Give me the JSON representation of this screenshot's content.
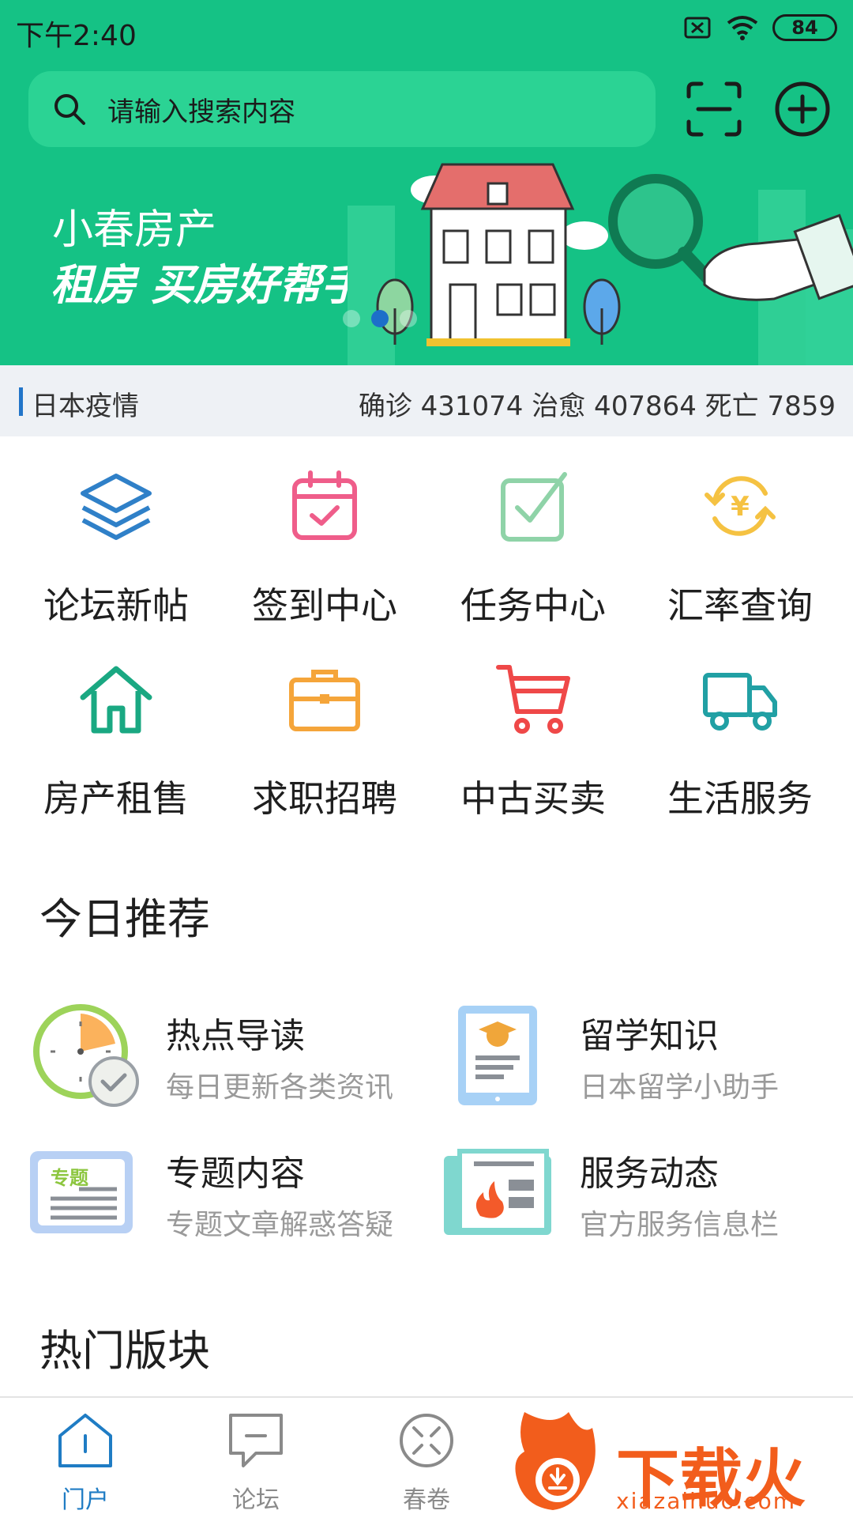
{
  "status_bar": {
    "time": "下午2:40",
    "battery": "84"
  },
  "search": {
    "placeholder": "请输入搜索内容"
  },
  "banner": {
    "title": "小春房产",
    "subtitle": "租房 买房好帮手"
  },
  "ticker": {
    "title": "日本疫情",
    "stats": "确诊 431074 治愈 407864 死亡 7859"
  },
  "grid": [
    {
      "label": "论坛新帖",
      "icon": "layers-icon",
      "color": "#2f80c8"
    },
    {
      "label": "签到中心",
      "icon": "calendar-check-icon",
      "color": "#ef5d8a"
    },
    {
      "label": "任务中心",
      "icon": "checkbox-icon",
      "color": "#8fd3a8"
    },
    {
      "label": "汇率查询",
      "icon": "currency-exchange-icon",
      "color": "#f5c242"
    },
    {
      "label": "房产租售",
      "icon": "house-icon",
      "color": "#1aa882"
    },
    {
      "label": "求职招聘",
      "icon": "briefcase-icon",
      "color": "#f5a53a"
    },
    {
      "label": "中古买卖",
      "icon": "cart-icon",
      "color": "#ef4848"
    },
    {
      "label": "生活服务",
      "icon": "truck-icon",
      "color": "#21a0a4"
    }
  ],
  "today": {
    "title": "今日推荐",
    "items": [
      {
        "title": "热点导读",
        "subtitle": "每日更新各类资讯",
        "icon": "clock-check-icon"
      },
      {
        "title": "留学知识",
        "subtitle": "日本留学小助手",
        "icon": "graduation-tablet-icon"
      },
      {
        "title": "专题内容",
        "subtitle": "专题文章解惑答疑",
        "icon": "topic-doc-icon",
        "badge": "专题"
      },
      {
        "title": "服务动态",
        "subtitle": "官方服务信息栏",
        "icon": "newspaper-fire-icon"
      }
    ]
  },
  "hot": {
    "title": "热门版块"
  },
  "tabbar": [
    {
      "label": "门户",
      "icon": "portal-home-icon",
      "active": true
    },
    {
      "label": "论坛",
      "icon": "chat-bubble-icon",
      "active": false
    },
    {
      "label": "春卷",
      "icon": "compass-icon",
      "active": false
    }
  ],
  "watermark": {
    "text": "下载火",
    "url": "xiazaihuo.com"
  },
  "colors": {
    "primary_green": "#15c285",
    "tab_active": "#1f7cc4"
  }
}
